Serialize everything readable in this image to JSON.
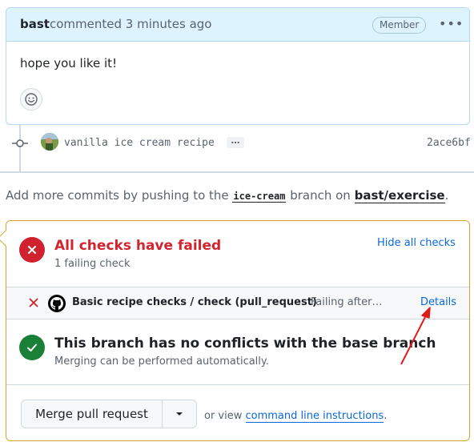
{
  "comment": {
    "author": "bast",
    "meta": "commented 3 minutes ago",
    "badge": "Member",
    "kebab": "•••",
    "body": "hope you like it!"
  },
  "commit": {
    "message": "vanilla ice cream recipe",
    "more": "…",
    "sha": "2ace6bf"
  },
  "hint": {
    "prefix": "Add more commits by pushing to the ",
    "branch": "ice-cream",
    "middle": " branch on ",
    "repo": "bast/exercise",
    "suffix": "."
  },
  "checks": {
    "title": "All checks have failed",
    "subtitle": "1 failing check",
    "hide_label": "Hide all checks",
    "row": {
      "name": "Basic recipe checks / check (pull_request)",
      "status": "Failing after…",
      "details_label": "Details"
    }
  },
  "conflicts": {
    "title": "This branch has no conflicts with the base branch",
    "subtitle": "Merging can be performed automatically."
  },
  "merge": {
    "button_label": "Merge pull request",
    "or_view": "or view ",
    "cli_label": "command line instructions",
    "suffix": "."
  },
  "colors": {
    "fail": "#cf222e",
    "success": "#1a7f37",
    "link": "#0969da",
    "annotation_arrow": "#e01b1b"
  }
}
